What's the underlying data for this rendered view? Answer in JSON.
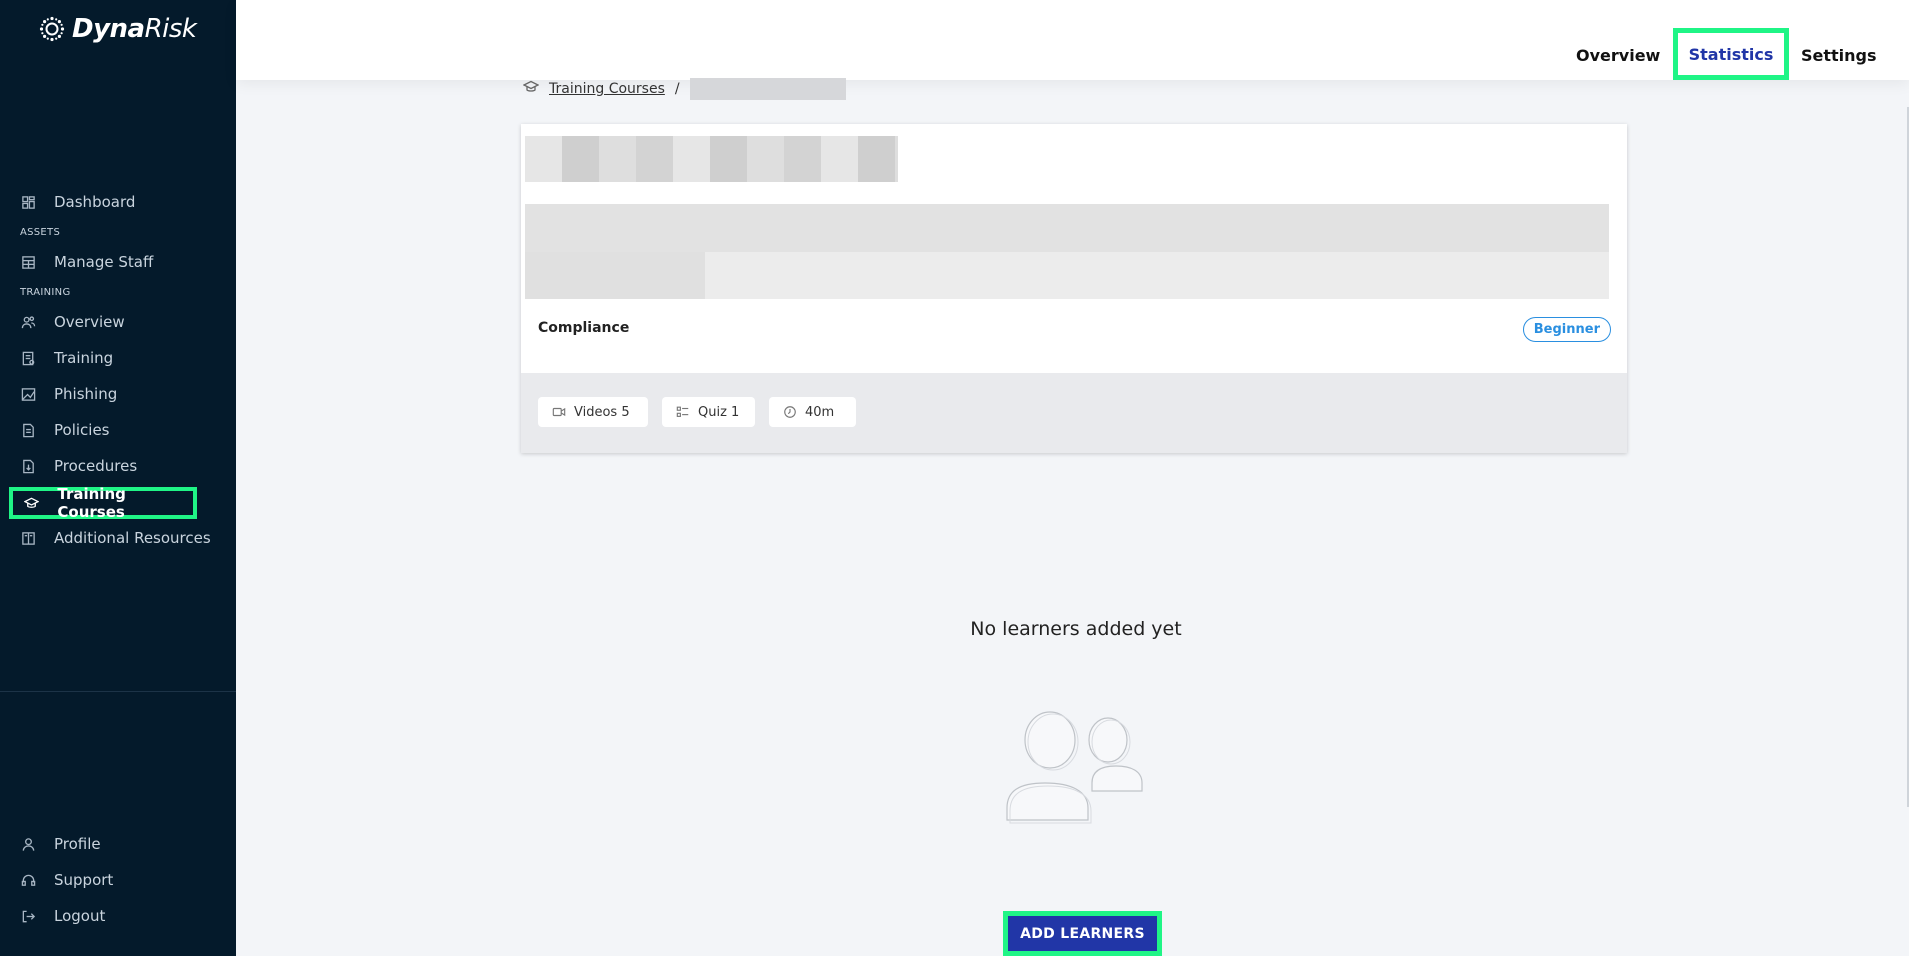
{
  "app": {
    "brand_bold": "Dyna",
    "brand_light": "Risk"
  },
  "sidebar": {
    "dashboard": "Dashboard",
    "section_assets": "ASSETS",
    "manage_staff": "Manage Staff",
    "section_training": "TRAINING",
    "overview": "Overview",
    "training": "Training",
    "phishing": "Phishing",
    "policies": "Policies",
    "procedures": "Procedures",
    "training_courses": "Training Courses",
    "additional_resources": "Additional Resources",
    "profile": "Profile",
    "support": "Support",
    "logout": "Logout"
  },
  "topbar": {
    "tabs": [
      {
        "label": "Overview"
      },
      {
        "label": "Statistics",
        "active": true
      },
      {
        "label": "Settings"
      }
    ]
  },
  "breadcrumb": {
    "parent": "Training Courses",
    "separator": "/"
  },
  "course": {
    "category": "Compliance",
    "level": "Beginner",
    "videos": "Videos 5",
    "quiz": "Quiz 1",
    "duration": "40m"
  },
  "empty_state": {
    "message": "No learners added yet",
    "button": "ADD LEARNERS"
  },
  "colors": {
    "sidebar_bg": "#041a2b",
    "accent": "#2136a7",
    "highlight": "#1ff586",
    "badge": "#2a8fe0"
  }
}
